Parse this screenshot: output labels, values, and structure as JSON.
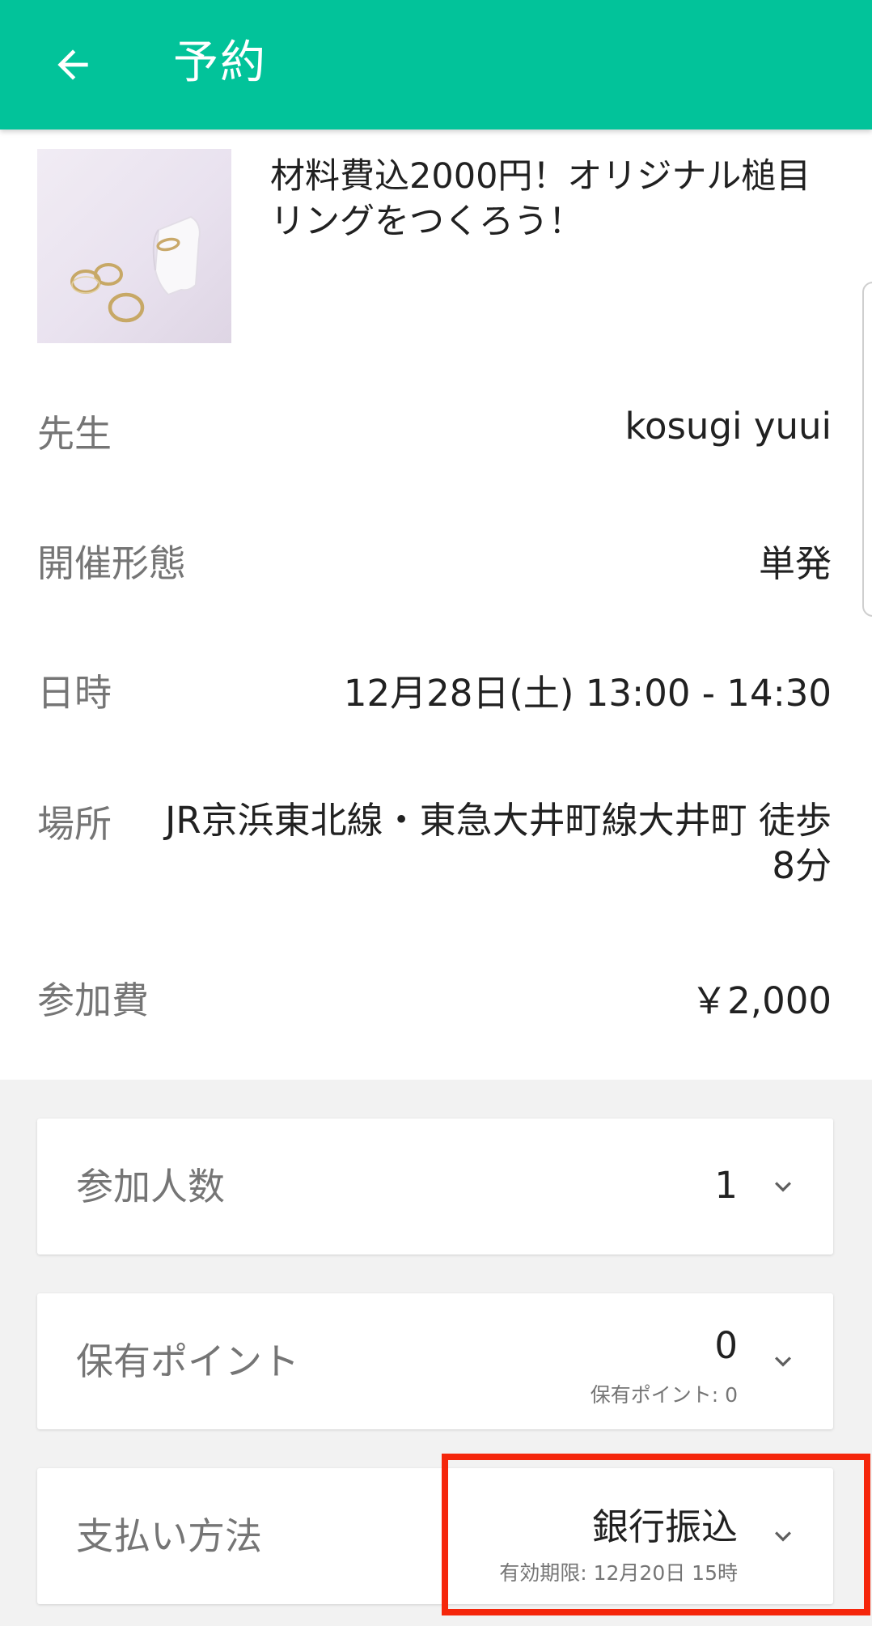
{
  "header": {
    "title": "予約",
    "back_icon": "arrow-left-icon",
    "background_color": "#02c39a"
  },
  "lesson": {
    "title": "材料費込2000円！オリジナル槌目リングをつくろう！",
    "image_alt": "gold rings on white leather"
  },
  "details": {
    "teacher": {
      "label": "先生",
      "value": "kosugi yuui"
    },
    "format": {
      "label": "開催形態",
      "value": "単発"
    },
    "datetime": {
      "label": "日時",
      "value": "12月28日(土) 13:00 - 14:30"
    },
    "place": {
      "label": "場所",
      "value_line1": "JR京浜東北線・東急大井町線大井町 徒歩",
      "value_line2": "8分"
    },
    "fee": {
      "label": "参加費",
      "value": "￥2,000"
    }
  },
  "options": {
    "people": {
      "label": "参加人数",
      "value": "1",
      "icon": "chevron-down-icon"
    },
    "points": {
      "label": "保有ポイント",
      "value": "0",
      "sub": "保有ポイント: 0",
      "icon": "chevron-down-icon"
    },
    "payment": {
      "label": "支払い方法",
      "value": "銀行振込",
      "sub": "有効期限: 12月20日 15時",
      "icon": "chevron-down-icon"
    }
  },
  "colors": {
    "accent": "#02c39a",
    "highlight": "#f5260b",
    "section_background": "#f2f2f2"
  }
}
